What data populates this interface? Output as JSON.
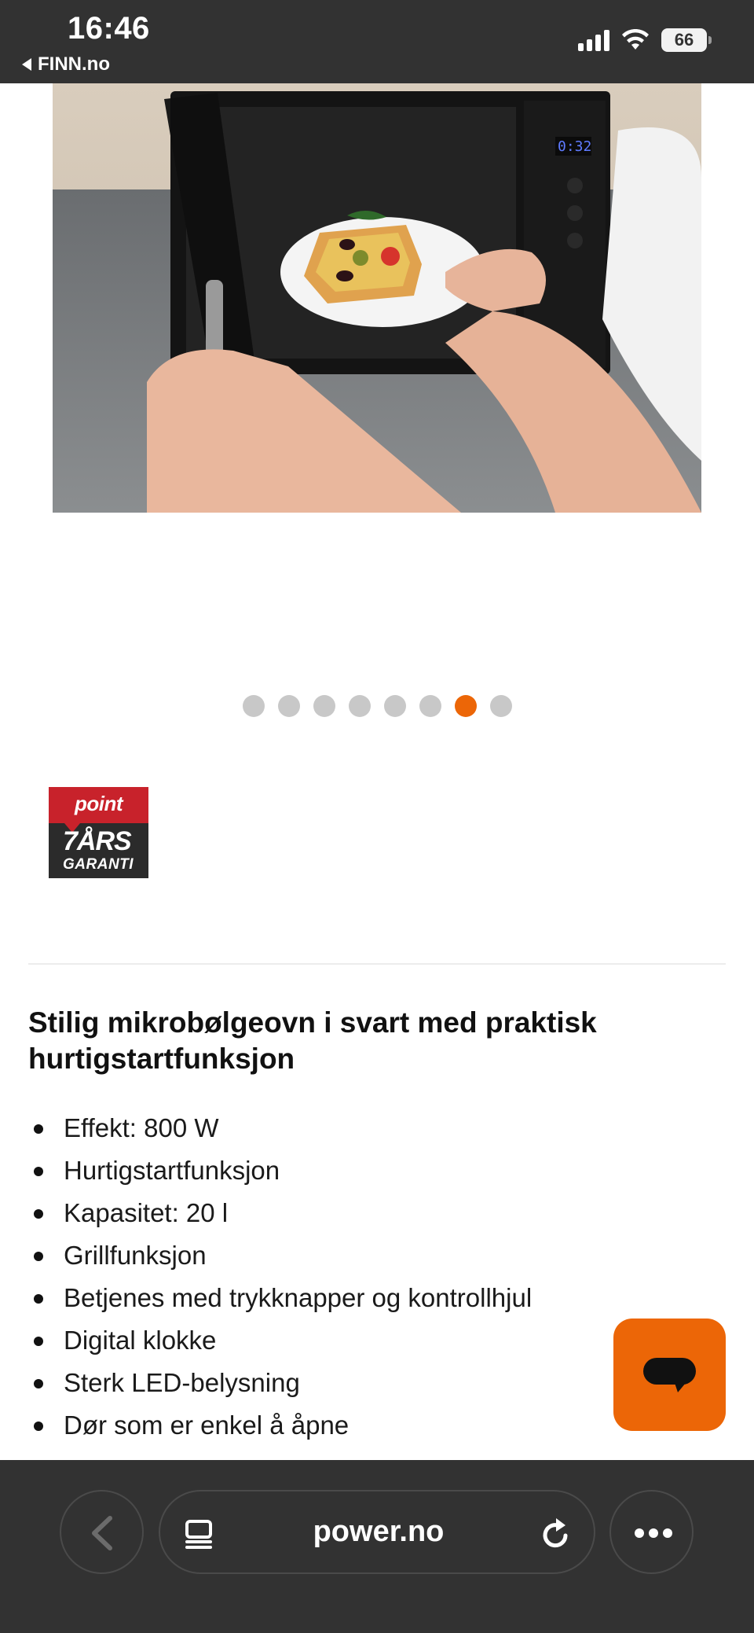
{
  "status_bar": {
    "time": "16:46",
    "back_app": "FINN.no",
    "battery": "66"
  },
  "product": {
    "image_alt": "Person placing a plate with pizza into a black microwave oven",
    "display_time": "0:32",
    "carousel": {
      "count": 8,
      "active_index": 6
    },
    "badge": {
      "brand": "point",
      "years": "7ÅRS",
      "sub": "GARANTI"
    },
    "headline": "Stilig mikrobølgeovn i svart med praktisk hurtigstartfunksjon",
    "features": [
      "Effekt: 800 W",
      "Hurtigstartfunksjon",
      "Kapasitet: 20 l",
      "Grillfunksjon",
      "Betjenes med trykknapper og kontrollhjul",
      "Digital klokke",
      "Sterk LED-belysning",
      "Dør som er enkel å åpne"
    ]
  },
  "browser": {
    "url": "power.no"
  },
  "colors": {
    "accent": "#ec6607",
    "chrome": "#323232",
    "dot_inactive": "#c8c8c8"
  }
}
